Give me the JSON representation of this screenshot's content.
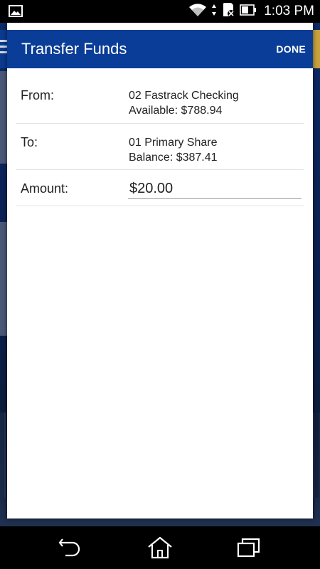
{
  "status_bar": {
    "time": "1:03 PM",
    "icons": [
      "image-icon",
      "wifi-icon",
      "data-arrows-icon",
      "sd-card-icon",
      "battery-icon"
    ]
  },
  "dialog": {
    "title": "Transfer Funds",
    "done_label": "DONE",
    "from": {
      "label": "From:",
      "account": "02 Fastrack Checking",
      "detail": "Available: $788.94"
    },
    "to": {
      "label": "To:",
      "account": "01 Primary Share",
      "detail": "Balance: $387.41"
    },
    "amount": {
      "label": "Amount:",
      "value": "$20.00"
    }
  },
  "nav_bar": {
    "icons": [
      "back-icon",
      "home-icon",
      "recents-icon"
    ]
  },
  "colors": {
    "toolbar": "#0a3d98",
    "dialog_bg": "#ffffff",
    "divider": "#e3e3e3"
  }
}
